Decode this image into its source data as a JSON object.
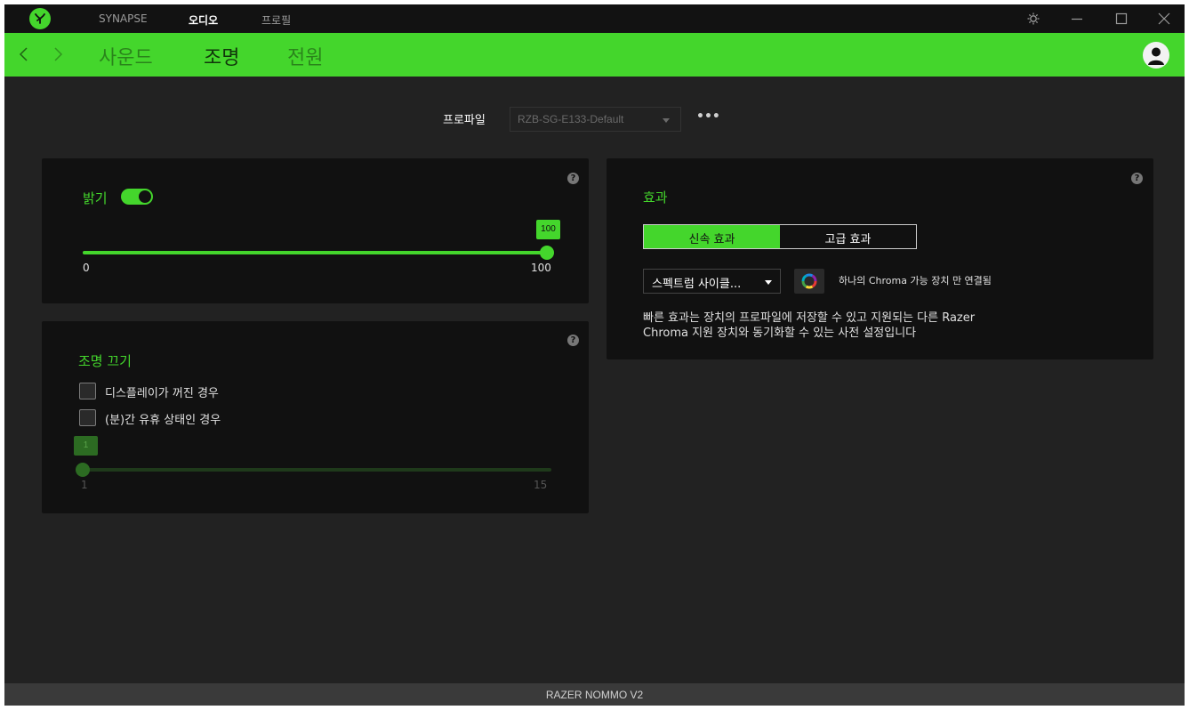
{
  "titlebar": {
    "tabs": [
      {
        "label": "SYNAPSE",
        "active": false
      },
      {
        "label": "오디오",
        "active": true
      },
      {
        "label": "프로필",
        "active": false
      }
    ],
    "icons": [
      "settings-icon",
      "minimize-icon",
      "maximize-icon",
      "close-icon"
    ]
  },
  "nav": {
    "tabs": [
      {
        "label": "사운드",
        "active": false
      },
      {
        "label": "조명",
        "active": true
      },
      {
        "label": "전원",
        "active": false
      }
    ]
  },
  "profile": {
    "label": "프로파일",
    "selected": "RZB-SG-E133-Default",
    "more": "•••"
  },
  "brightness": {
    "label": "밝기",
    "enabled": true,
    "value": "100",
    "min": "0",
    "max": "100",
    "fraction": 1.0
  },
  "lights_off": {
    "title": "조명 끄기",
    "options": [
      {
        "label": "디스플레이가 꺼진 경우",
        "checked": false
      },
      {
        "label": "(분)간 유휴 상태인 경우",
        "checked": false
      }
    ],
    "value": "1",
    "min": "1",
    "max": "15",
    "fraction": 0.0
  },
  "effects": {
    "title": "효과",
    "tabs": [
      {
        "label": "신속 효과",
        "active": true
      },
      {
        "label": "고급 효과",
        "active": false
      }
    ],
    "selected_effect": "스펙트럼 사이클...",
    "chroma_note": "하나의 Chroma 가능 장치 만 연결됨",
    "description_lines": [
      "빠른 효과는 장치의 프로파일에 저장할 수 있고 지원되는 다른 Razer",
      "Chroma 지원 장치와 동기화할 수 있는 사전 설정입니다"
    ]
  },
  "help_icon": "?",
  "status": "RAZER NOMMO V2",
  "colors": {
    "accent": "#44d62c",
    "background": "#222222",
    "panel": "#111111",
    "titlebar": "#121212",
    "statusbar": "#3a3a3a",
    "disabled_green": "#2c6b22"
  }
}
